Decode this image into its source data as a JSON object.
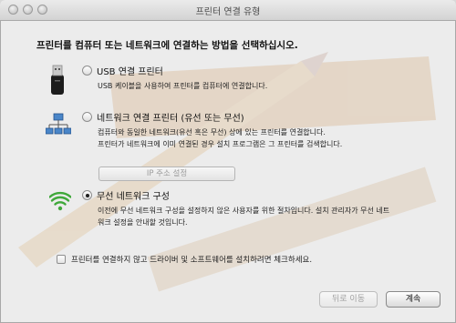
{
  "window": {
    "title": "프린터 연결 유형"
  },
  "heading": "프린터를 컴퓨터 또는 네트워크에 연결하는 방법을 선택하십시오.",
  "options": [
    {
      "label": "USB 연결 프린터",
      "selected": false,
      "icon": "usb-plug-icon",
      "description": [
        "USB 케이블을 사용하여 프린터를 컴퓨터에 연결합니다."
      ]
    },
    {
      "label": "네트워크 연결 프린터 (유선 또는 무선)",
      "selected": false,
      "icon": "network-icon",
      "description": [
        "컴퓨터와 동일한 네트워크(유선 혹은 무선) 상에 있는 프린터를 연결합니다.",
        "프린터가 네트워크에 이미 연결된 경우 설치 프로그램은 그 프린터를 검색합니다."
      ]
    },
    {
      "label": "무선 네트워크 구성",
      "selected": true,
      "icon": "wifi-icon",
      "description": [
        "이전에 무선 네트워크 구성을 설정하지 않은 사용자를 위한 절차입니다. 설치 관리자가 무선 네트",
        "워크 설정을 안내할 것입니다."
      ]
    }
  ],
  "ip_button": {
    "label": "IP 주소 설정",
    "enabled": false
  },
  "checkbox": {
    "label": "프린터를 연결하지 않고 드라이버 및 소프트웨어를 설치하려면 체크하세요.",
    "checked": false
  },
  "buttons": {
    "back": "뒤로 이동",
    "continue": "계속"
  },
  "colors": {
    "wifi_green": "#3fa83a",
    "accent_window": "#ececec"
  }
}
